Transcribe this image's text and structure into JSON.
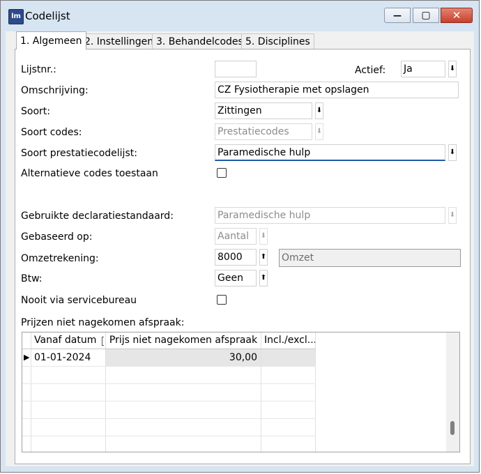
{
  "window": {
    "title": "Codelijst",
    "icon_text": "lm",
    "minimize_symbol": "—",
    "maximize_symbol": "▢",
    "close_symbol": "✕"
  },
  "tabs": [
    {
      "label": "1. Algemeen",
      "active": true
    },
    {
      "label": "2. Instellingen",
      "active": false
    },
    {
      "label": "3. Behandelcodes",
      "active": false
    },
    {
      "label": "5. Disciplines",
      "active": false
    }
  ],
  "form": {
    "lijstnr": {
      "label": "Lijstnr.:",
      "value": ""
    },
    "actief": {
      "label": "Actief:",
      "value": "Ja"
    },
    "omschrijving": {
      "label": "Omschrijving:",
      "value": "CZ Fysiotherapie met opslagen"
    },
    "soort": {
      "label": "Soort:",
      "value": "Zittingen"
    },
    "soort_codes": {
      "label": "Soort codes:",
      "value": "Prestatiecodes"
    },
    "soort_prestatiecodelijst": {
      "label": "Soort prestatiecodelijst:",
      "value": "Paramedische hulp"
    },
    "alternatieve_codes": {
      "label": "Alternatieve codes toestaan",
      "checked": false
    },
    "gebruikte_declaratiestandaard": {
      "label": "Gebruikte declaratiestandaard:",
      "value": "Paramedische hulp"
    },
    "gebaseerd_op": {
      "label": "Gebaseerd op:",
      "value": "Aantal"
    },
    "omzetrekening": {
      "label": "Omzetrekening:",
      "value": "8000",
      "description": "Omzet"
    },
    "btw": {
      "label": "Btw:",
      "value": "Geen"
    },
    "nooit_via_servicebureau": {
      "label": "Nooit via servicebureau",
      "checked": false
    },
    "prijzen_label": "Prijzen niet nagekomen afspraak:"
  },
  "grid": {
    "columns": [
      "Vanaf datum",
      "Prijs niet nagekomen afspraak",
      "Incl./excl..."
    ],
    "sort_icon": "↑",
    "row_marker": "▶",
    "rows": [
      {
        "vanaf_datum": "01-01-2024",
        "prijs": "30,00",
        "incl_excl": ""
      }
    ]
  },
  "colors": {
    "titlebar": "#d7e4f2",
    "close_button": "#c7412a",
    "focus_underline": "#1e5ba8",
    "selected_cell": "#e6e6e6"
  }
}
